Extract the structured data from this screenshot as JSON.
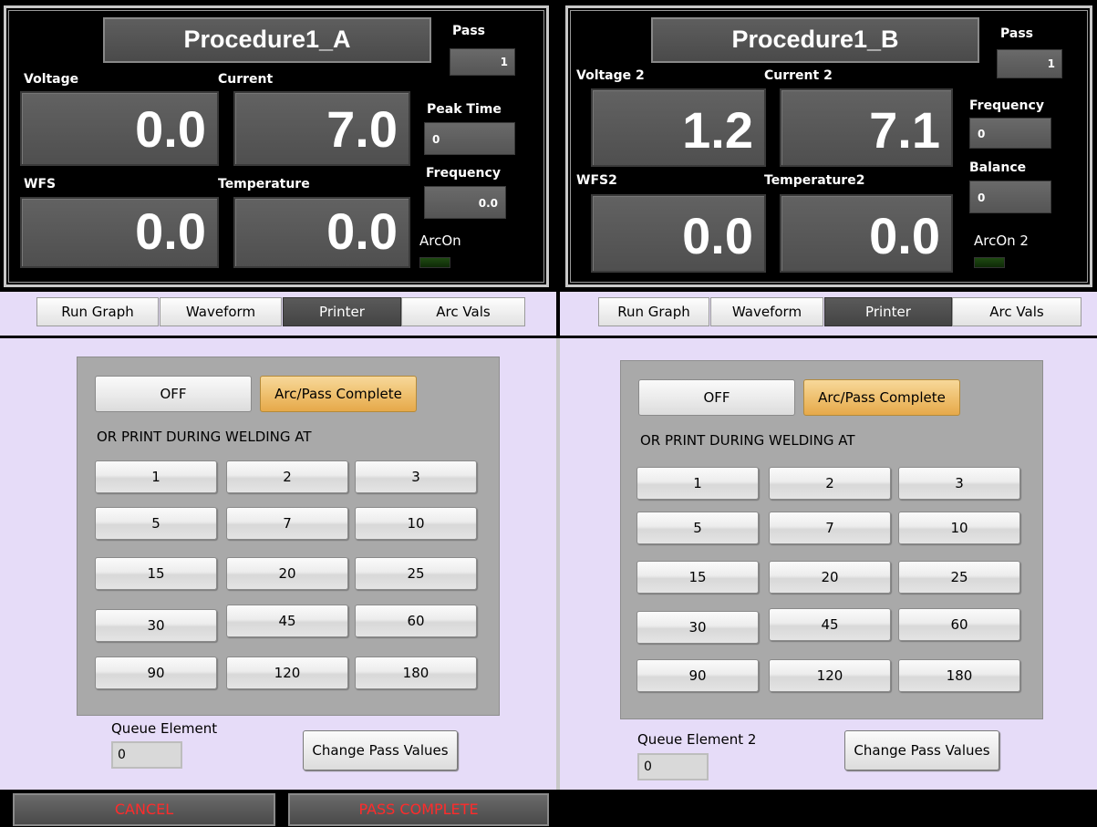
{
  "panelA": {
    "title": "Procedure1_A",
    "pass_label": "Pass",
    "pass_value": "1",
    "voltage_label": "Voltage",
    "voltage_value": "0.0",
    "current_label": "Current",
    "current_value": "7.0",
    "peak_time_label": "Peak Time",
    "peak_time_value": "0",
    "frequency_label": "Frequency",
    "frequency_value": "0.0",
    "wfs_label": "WFS",
    "wfs_value": "0.0",
    "temperature_label": "Temperature",
    "temperature_value": "0.0",
    "arcon_label": "ArcOn",
    "tabs": [
      "Run Graph",
      "Waveform",
      "Printer",
      "Arc Vals"
    ],
    "off_label": "OFF",
    "arc_pass_label": "Arc/Pass Complete",
    "print_during_label": "OR PRINT DURING WELDING AT",
    "intervals": [
      "1",
      "2",
      "3",
      "5",
      "7",
      "10",
      "15",
      "20",
      "25",
      "30",
      "45",
      "60",
      "90",
      "120",
      "180"
    ],
    "queue_label": "Queue Element",
    "queue_value": "0",
    "change_pass_label": "Change Pass Values"
  },
  "panelB": {
    "title": "Procedure1_B",
    "pass_label": "Pass",
    "pass_value": "1",
    "voltage_label": "Voltage 2",
    "voltage_value": "1.2",
    "current_label": "Current 2",
    "current_value": "7.1",
    "frequency_label": "Frequency",
    "frequency_value": "0",
    "balance_label": "Balance",
    "balance_value": "0",
    "wfs_label": "WFS2",
    "wfs_value": "0.0",
    "temperature_label": "Temperature2",
    "temperature_value": "0.0",
    "arcon_label": "ArcOn 2",
    "tabs": [
      "Run Graph",
      "Waveform",
      "Printer",
      "Arc Vals"
    ],
    "off_label": "OFF",
    "arc_pass_label": "Arc/Pass Complete",
    "print_during_label": "OR PRINT DURING WELDING AT",
    "intervals": [
      "1",
      "2",
      "3",
      "5",
      "7",
      "10",
      "15",
      "20",
      "25",
      "30",
      "45",
      "60",
      "90",
      "120",
      "180"
    ],
    "queue_label": "Queue Element 2",
    "queue_value": "0",
    "change_pass_label": "Change Pass Values"
  },
  "footer": {
    "cancel_label": "CANCEL",
    "pass_complete_label": "PASS COMPLETE"
  },
  "colors": {
    "accent_active": "#efc170",
    "lavender_bg": "#e6dcf8",
    "cancel_text": "#ff2b2b",
    "led_off": "#1f4a12"
  }
}
